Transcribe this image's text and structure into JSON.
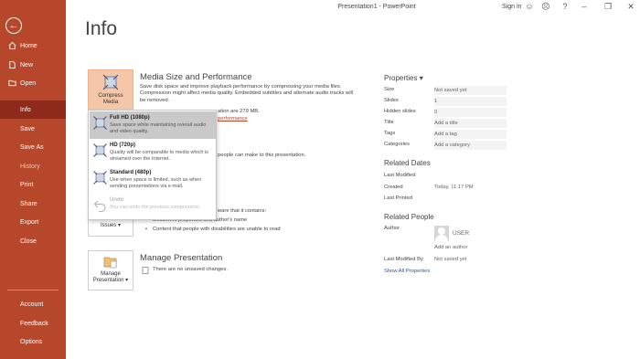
{
  "window": {
    "title": "Presentation1  -  PowerPoint",
    "signin": "Sign in"
  },
  "brand": {
    "accent": "#b7472a",
    "accent_dark": "#8e2a1b"
  },
  "sidebar": {
    "items": [
      {
        "label": "Home",
        "icon": "home-icon"
      },
      {
        "label": "New",
        "icon": "new-file-icon"
      },
      {
        "label": "Open",
        "icon": "folder-icon"
      },
      {
        "label": "Info",
        "active": true
      },
      {
        "label": "Save"
      },
      {
        "label": "Save As"
      },
      {
        "label": "History",
        "dim": true
      },
      {
        "label": "Print"
      },
      {
        "label": "Share"
      },
      {
        "label": "Export"
      },
      {
        "label": "Close"
      }
    ],
    "bottom": [
      {
        "label": "Account"
      },
      {
        "label": "Feedback"
      },
      {
        "label": "Options"
      }
    ]
  },
  "page": {
    "title": "Info"
  },
  "media": {
    "tile": "Compress Media",
    "title": "Media Size and Performance",
    "desc": "Save disk space and improve playback performance by compressing your media files. Compression might affect media quality. Embedded subtitles and alternate audio tracks will be removed.",
    "size_text": "ation are 279 MB.",
    "link": "performance"
  },
  "compress_menu": {
    "items": [
      {
        "title": "Full HD (1080p)",
        "desc": "Save space while maintaining overall audio and video quality.",
        "selected": true
      },
      {
        "title": "HD (720p)",
        "desc": "Quality will be comparable to media which is streamed over the Internet."
      },
      {
        "title": "Standard (480p)",
        "desc": "Use when space is limited, such as when sending presentations via e-mail."
      },
      {
        "title": "Undo",
        "desc": "You can undo the previous compression.",
        "disabled": true
      }
    ]
  },
  "protect": {
    "text": "people can make to this presentation."
  },
  "inspect": {
    "tile": "Issues",
    "text": "ware that it contains:",
    "bullets": [
      "Document properties and author's name",
      "Content that people with disabilities are unable to read"
    ]
  },
  "manage": {
    "tile_line1": "Manage",
    "tile_line2": "Presentation",
    "title": "Manage Presentation",
    "status": "There are no unsaved changes."
  },
  "properties": {
    "header": "Properties",
    "rows": [
      {
        "label": "Size",
        "value": "Not saved yet"
      },
      {
        "label": "Slides",
        "value": "1"
      },
      {
        "label": "Hidden slides",
        "value": "0"
      },
      {
        "label": "Title",
        "value": "Add a title"
      },
      {
        "label": "Tags",
        "value": "Add a tag"
      },
      {
        "label": "Categories",
        "value": "Add a category"
      }
    ]
  },
  "related_dates": {
    "header": "Related Dates",
    "rows": [
      {
        "label": "Last Modified",
        "value": ""
      },
      {
        "label": "Created",
        "value": "Today, 11:17 PM"
      },
      {
        "label": "Last Printed",
        "value": ""
      }
    ]
  },
  "related_people": {
    "header": "Related People",
    "author_label": "Author",
    "author": "USER",
    "add_author": "Add an author",
    "last_modified_label": "Last Modified By",
    "last_modified": "Not saved yet",
    "show_all": "Show All Properties"
  }
}
